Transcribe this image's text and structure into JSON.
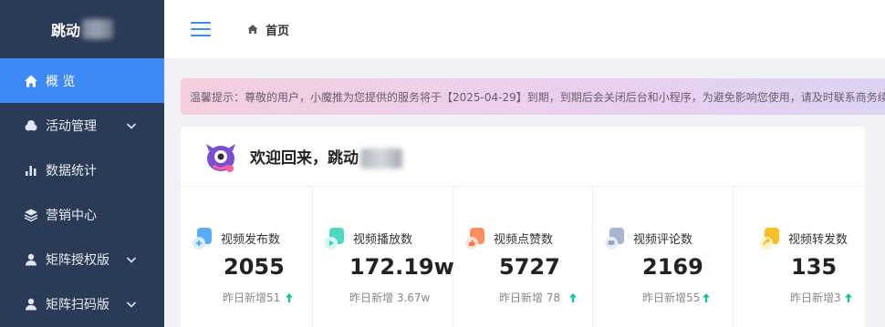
{
  "sidebar": {
    "brand": "跳动",
    "items": [
      {
        "label": "概 览",
        "icon": "home-icon",
        "active": true,
        "has_children": false
      },
      {
        "label": "活动管理",
        "icon": "cloud-icon",
        "active": false,
        "has_children": true
      },
      {
        "label": "数据统计",
        "icon": "bar-chart-icon",
        "active": false,
        "has_children": false
      },
      {
        "label": "营销中心",
        "icon": "layers-icon",
        "active": false,
        "has_children": false
      },
      {
        "label": "矩阵授权版",
        "icon": "user-icon",
        "active": false,
        "has_children": true
      },
      {
        "label": "矩阵扫码版",
        "icon": "user-icon",
        "active": false,
        "has_children": true
      }
    ]
  },
  "header": {
    "menu_icon": "hamburger-icon",
    "breadcrumb": "首页"
  },
  "notice": {
    "text": "温馨提示：尊敬的用户，小魔推为您提供的服务将于【2025-04-29】到期，到期后会关闭后台和小程序，为避免影响您使用，请及时联系商务续签"
  },
  "welcome": {
    "text": "欢迎回来，跳动"
  },
  "stats": [
    {
      "label": "视频发布数",
      "value": "2055",
      "sub": "昨日新增51",
      "trend_up": true,
      "icon_color": "#3aa0f5"
    },
    {
      "label": "视频播放数",
      "value": "172.19w",
      "sub": "昨日新增 3.67w",
      "trend_up": false,
      "icon_color": "#2fd2b3"
    },
    {
      "label": "视频点赞数",
      "value": "5727",
      "sub": "昨日新增 78",
      "trend_up": true,
      "icon_color": "#ff7a45"
    },
    {
      "label": "视频评论数",
      "value": "2169",
      "sub": "昨日新增55",
      "trend_up": true,
      "icon_color": "#9aa8c4"
    },
    {
      "label": "视频转发数",
      "value": "135",
      "sub": "昨日新增3",
      "trend_up": true,
      "icon_color": "#f7b500"
    }
  ],
  "colors": {
    "sidebar_bg": "#2b3a55",
    "accent": "#3d8af7",
    "trend_up": "#19be9b"
  }
}
